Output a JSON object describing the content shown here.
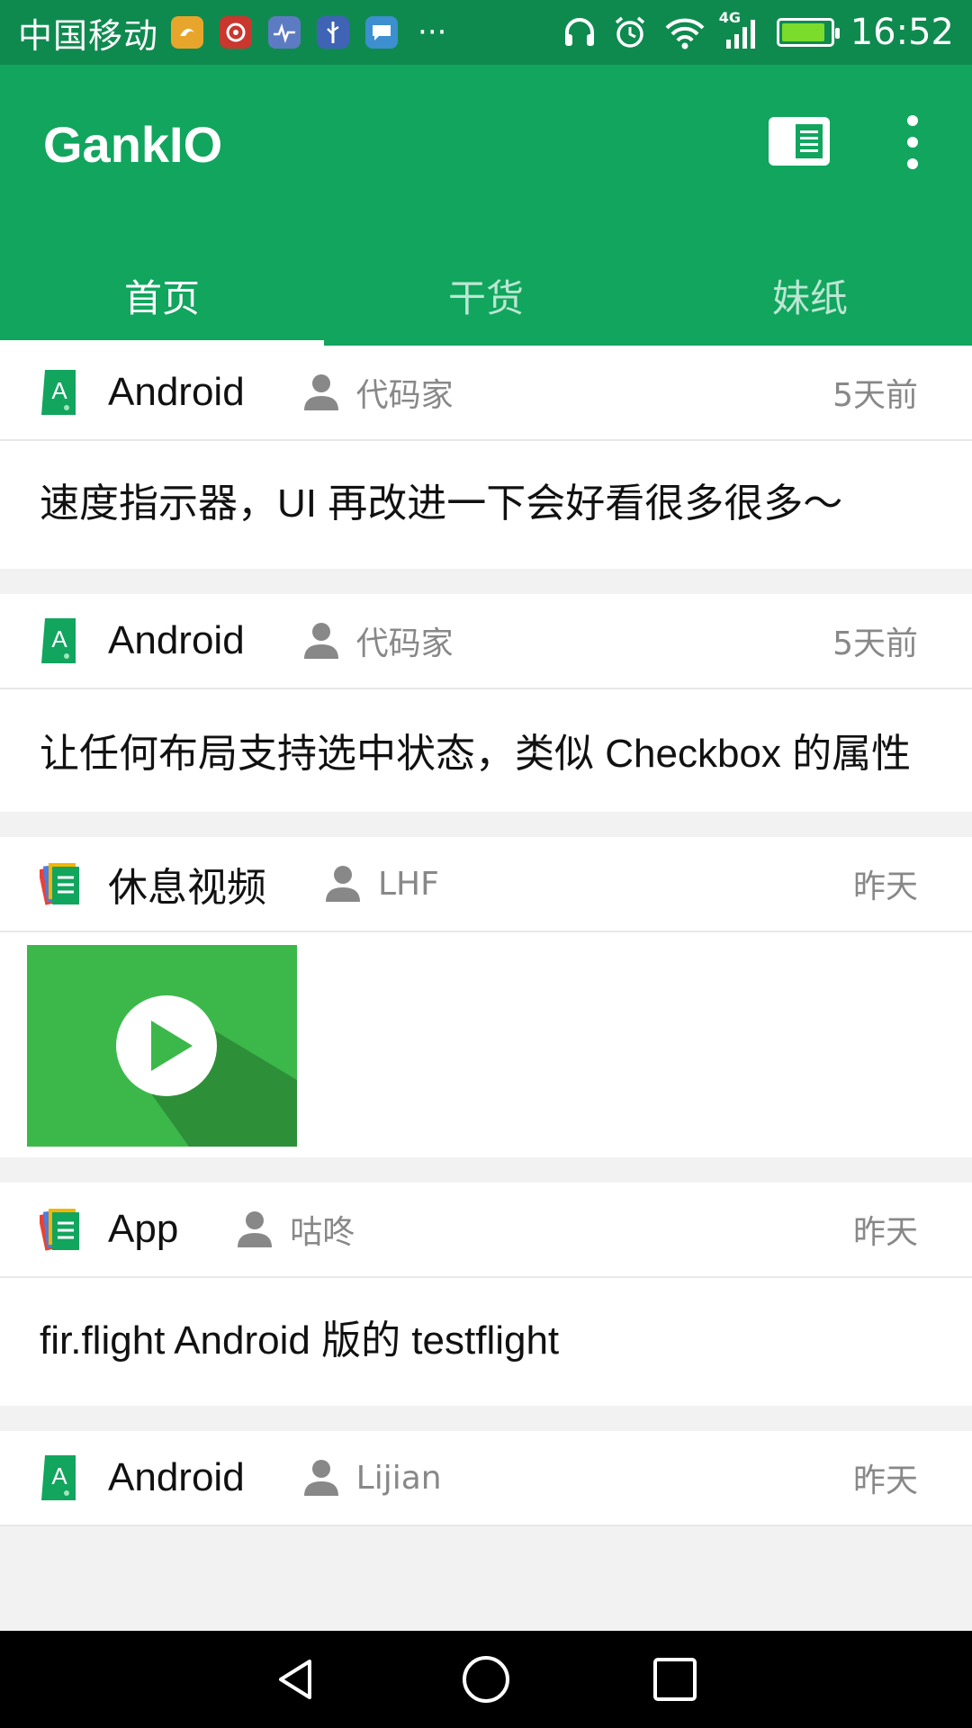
{
  "status_bar": {
    "carrier": "中国移动",
    "network": "4G",
    "time": "16:52",
    "more": "···",
    "battery_level": 0.9,
    "icons": [
      "uc-browser-icon",
      "netease-music-icon",
      "health-icon",
      "usb-icon",
      "message-icon",
      "headset-icon",
      "alarm-icon",
      "wifi-icon",
      "signal-icon",
      "battery-icon"
    ]
  },
  "app_bar": {
    "title": "GankIO",
    "color": "#11a55e"
  },
  "tabs": [
    {
      "label": "首页",
      "active": true
    },
    {
      "label": "干货",
      "active": false
    },
    {
      "label": "妹纸",
      "active": false
    }
  ],
  "feed": [
    {
      "type": "Android",
      "author": "代码家",
      "time": "5天前",
      "title": "速度指示器，UI 再改进一下会好看很多很多～"
    },
    {
      "type": "Android",
      "author": "代码家",
      "time": "5天前",
      "title": "让任何布局支持选中状态，类似 Checkbox 的属性"
    },
    {
      "type": "休息视频",
      "author": "LHF",
      "time": "昨天"
    },
    {
      "type": "App",
      "author": "咕咚",
      "time": "昨天",
      "title": "fir.flight Android 版的 testflight"
    },
    {
      "type": "Android",
      "author": "Lijian",
      "time": "昨天"
    }
  ]
}
